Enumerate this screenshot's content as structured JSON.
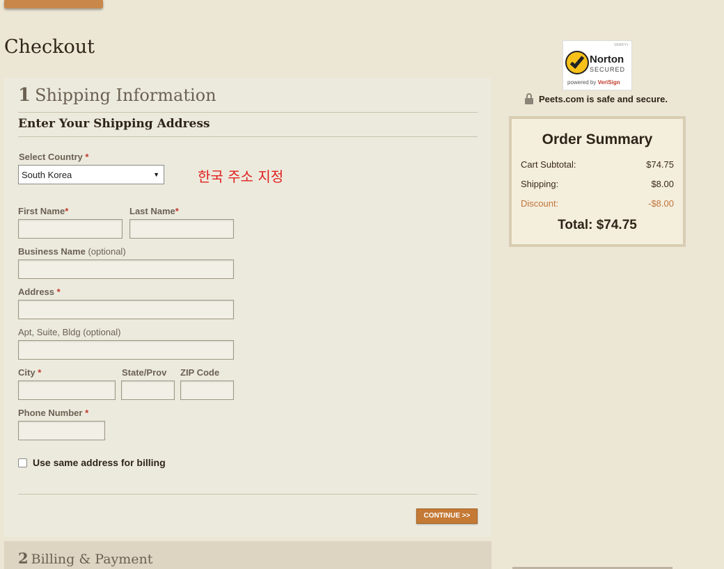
{
  "page_title": "Checkout",
  "shipping": {
    "step_number": "1",
    "step_title": "Shipping Information",
    "subheading": "Enter Your Shipping Address",
    "country_label": "Select Country",
    "country_value": "South Korea",
    "annotation": "한국 주소 지정",
    "first_name_label": "First Name",
    "last_name_label": "Last Name",
    "business_label": "Business Name",
    "business_optional": "(optional)",
    "address_label": "Address",
    "apt_label": "Apt, Suite, Bldg (optional)",
    "city_label": "City",
    "state_label": "State/Prov",
    "zip_label": "ZIP Code",
    "phone_label": "Phone Number",
    "required_mark": "*",
    "same_billing_label": "Use same address for billing",
    "continue_label": "CONTINUE >>"
  },
  "billing": {
    "step_number": "2",
    "step_title": "Billing & Payment"
  },
  "trust": {
    "verify_text": "VERIFY+",
    "norton_line1": "Norton",
    "norton_line2": "SECURED",
    "powered_prefix": "powered by",
    "powered_brand": "VeriSign",
    "secure_text": "Peets.com is safe and secure."
  },
  "order_summary": {
    "title": "Order Summary",
    "subtotal_label": "Cart Subtotal:",
    "subtotal_value": "$74.75",
    "shipping_label": "Shipping:",
    "shipping_value": "$8.00",
    "discount_label": "Discount:",
    "discount_value": "-$8.00",
    "total_label": "Total:",
    "total_value": "$74.75"
  },
  "colors": {
    "accent": "#c47a35",
    "required": "#c0392b",
    "annotation": "#e02020"
  }
}
